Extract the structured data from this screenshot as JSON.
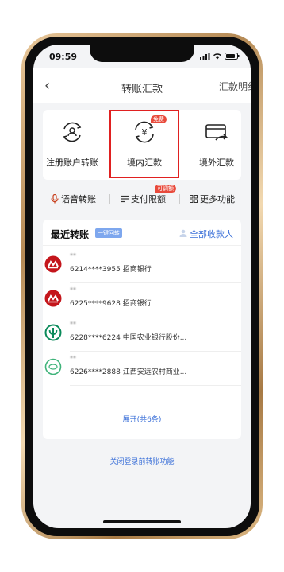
{
  "status_bar": {
    "time": "09:59"
  },
  "nav": {
    "title": "转账汇款",
    "detail_label": "汇款明细"
  },
  "features": [
    {
      "label": "注册账户转账",
      "icon": "registered-account-icon"
    },
    {
      "label": "境内汇款",
      "icon": "yuan-transfer-icon",
      "badge": "免费"
    },
    {
      "label": "境外汇款",
      "icon": "overseas-card-icon"
    }
  ],
  "quick_actions": [
    {
      "label": "语音转账",
      "icon": "microphone-icon"
    },
    {
      "label": "支付限额",
      "icon": "list-icon",
      "badge": "可调额"
    },
    {
      "label": "更多功能",
      "icon": "grid-icon"
    }
  ],
  "recent": {
    "title": "最近转账",
    "tag": "一键回转",
    "all_payees": "全部收款人",
    "items": [
      {
        "name": "**",
        "account": "6214****3955",
        "bank": "招商银行",
        "logo": "cmb-logo",
        "color": "#c4161c"
      },
      {
        "name": "**",
        "account": "6225****9628",
        "bank": "招商银行",
        "logo": "cmb-logo",
        "color": "#c4161c"
      },
      {
        "name": "**",
        "account": "6228****6224",
        "bank": "中国农业银行股份...",
        "logo": "abc-logo",
        "color": "#0a8a5a"
      },
      {
        "name": "**",
        "account": "6226****2888",
        "bank": "江西安远农村商业...",
        "logo": "rural-bank-logo",
        "color": "#3fb37a"
      }
    ],
    "expand_label": "展开(共6条)"
  },
  "footer_link": "关闭登录前转账功能",
  "colors": {
    "accent_blue": "#3a6fd8",
    "highlight_red": "#e02020",
    "badge_red": "#e84a3c"
  }
}
